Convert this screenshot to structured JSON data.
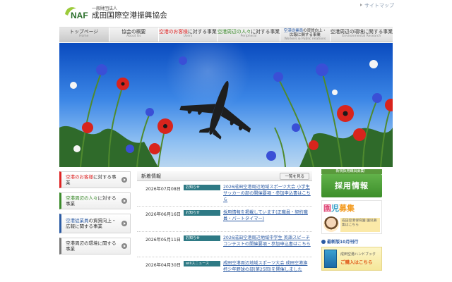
{
  "header": {
    "logo_mark": "NAF",
    "logo_sub": "一般財団法人",
    "logo_name": "成田国際空港振興協会",
    "sitemap_label": "サイトマップ"
  },
  "nav": [
    {
      "jp": "トップページ",
      "en": "Home"
    },
    {
      "jp_pre": "",
      "jp_hl": "",
      "jp_post": "協会の概要",
      "en": "About Us"
    },
    {
      "jp_hl": "空港のお客様",
      "jp_post": "に対する事業",
      "en": "Users"
    },
    {
      "jp_hl": "空港周辺の人々",
      "jp_post": "に対する事業",
      "en": "Peripheral"
    },
    {
      "jp_hl": "空港従業員",
      "jp_post": "の資質向上・",
      "jp_line2": "広報に関する事業",
      "en": "Workers & Public relations"
    },
    {
      "jp_hl": "",
      "jp_post": "空港周辺の環境に関する事業",
      "en": "Environmental Research"
    }
  ],
  "side": [
    {
      "hl": "空港のお客様",
      "post": "に対する事業"
    },
    {
      "hl": "空港周辺の人々",
      "post": "に対する事業"
    },
    {
      "hl": "空港従業員",
      "post": "の資質向上・広報に関する事業"
    },
    {
      "hl": "",
      "post": "空港周辺の環境に関する事業"
    }
  ],
  "news": {
    "title": "新着情報",
    "all_label": "一覧を見る",
    "items": [
      {
        "date": "2026年07月08日",
        "category": "お知らせ",
        "text": "2026成田空港周辺地域スポーツ大会 小学生サッカーの部の開催要項・参加申込書はこちら"
      },
      {
        "date": "2026年06月16日",
        "category": "お知らせ",
        "text": "採用情報を掲載しています(正職員・契約職員・パートタイマー)"
      },
      {
        "date": "2026年05月11日",
        "category": "お知らせ",
        "text": "2026成田空港周辺地域中学生 英語スピーチコンテストの開催要項・参加申込書はこちら"
      },
      {
        "date": "2026年04月30日",
        "category": "willスニュース",
        "text": "成田空港周辺地域スポーツ大会 成田空港旗杯少年野球の部(第25回)を開催しました"
      }
    ]
  },
  "right": {
    "recruit_top": "新規採用職員募集！",
    "recruit": "採用情報",
    "boshu_a": "園",
    "boshu_b": "児",
    "boshu_c": "募集",
    "boshu_text": "成田空港保育園 園児募集はこちら",
    "monthly": "最新版10月刊行",
    "handbook_t1": "成田空港ハンドブック",
    "handbook_t2": "ご購入はこちら"
  },
  "colors": {
    "accent_red": "#dd2222",
    "accent_green": "#3a8a2a",
    "accent_blue": "#2b5aa3",
    "category_bg": "#2e7a85"
  }
}
